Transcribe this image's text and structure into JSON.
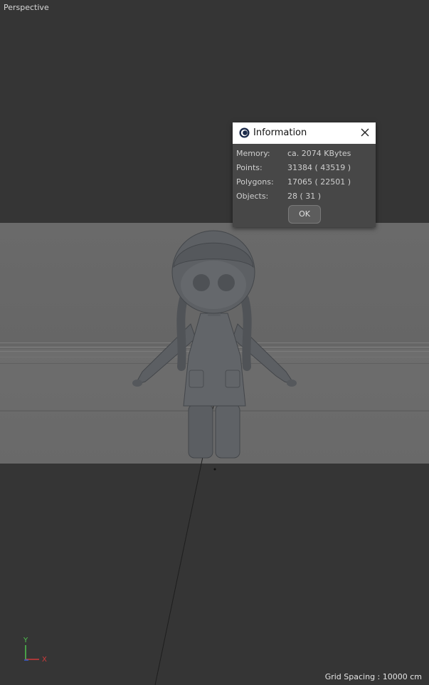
{
  "viewport": {
    "label": "Perspective"
  },
  "dialog": {
    "title": "Information",
    "rows": [
      {
        "key": "Memory:",
        "value": "ca. 2074 KBytes"
      },
      {
        "key": "Points:",
        "value": "31384 ( 43519 )"
      },
      {
        "key": "Polygons:",
        "value": "17065 ( 22501 )"
      },
      {
        "key": "Objects:",
        "value": "28 ( 31 )"
      }
    ],
    "ok_label": "OK"
  },
  "gizmo": {
    "y_label": "Y",
    "x_label": "X"
  },
  "status": {
    "grid_spacing": "Grid Spacing : 10000 cm"
  },
  "colors": {
    "x_axis": "#d03a3a",
    "y_axis": "#4fc44f",
    "z_axis": "#3a5fd0"
  }
}
